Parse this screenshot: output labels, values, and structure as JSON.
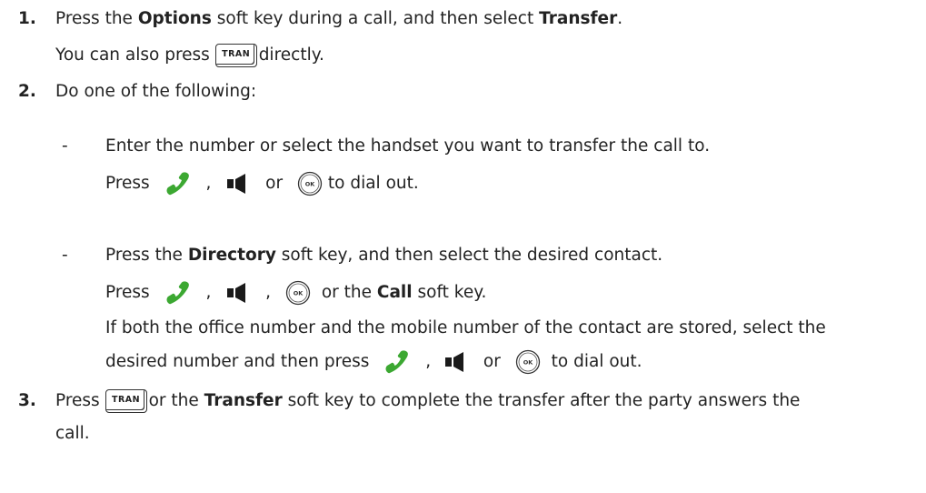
{
  "steps": [
    {
      "number": "1.",
      "line1": {
        "t1": "Press the ",
        "b1": "Options",
        "t2": " soft key during a call, and then select ",
        "b2": "Transfer",
        "t3": "."
      },
      "line2": {
        "t1": "You can also press ",
        "key": "TRAN",
        "t2": "directly."
      }
    },
    {
      "number": "2.",
      "text": "Do one of the following:",
      "options": [
        {
          "dash": "-",
          "text": "Enter the number or select the handset you want to transfer the call to.",
          "press": {
            "t1": "Press",
            "sep1": ",",
            "or": "or",
            "t2": "to dial out."
          }
        },
        {
          "dash": "-",
          "line1": {
            "t1": "Press the ",
            "b1": "Directory",
            "t2": " soft key, and then select the desired contact."
          },
          "press": {
            "t1": "Press",
            "sep1": ",",
            "sep2": ",",
            "t2": "or the ",
            "b1": "Call",
            "t3": " soft key."
          },
          "note_line1": "If both the office number and the mobile number of the contact are stored, select the",
          "note_line2": {
            "t1": "desired number and then press",
            "sep1": ",",
            "or": "or",
            "t2": "to dial out."
          }
        }
      ]
    },
    {
      "number": "3.",
      "line1": {
        "t1": "Press ",
        "key": "TRAN",
        "t2": "or the ",
        "b1": "Transfer",
        "t3": " soft key to complete the transfer after the party answers the"
      },
      "line2": "call."
    }
  ],
  "icons": {
    "handset": "green-phone-handset-icon",
    "speaker": "speakerphone-icon",
    "ok": "ok-key-icon",
    "tran": "tran-key-icon"
  },
  "colors": {
    "handset": "#3ca832",
    "text": "#222222"
  },
  "ok_label": "OK"
}
